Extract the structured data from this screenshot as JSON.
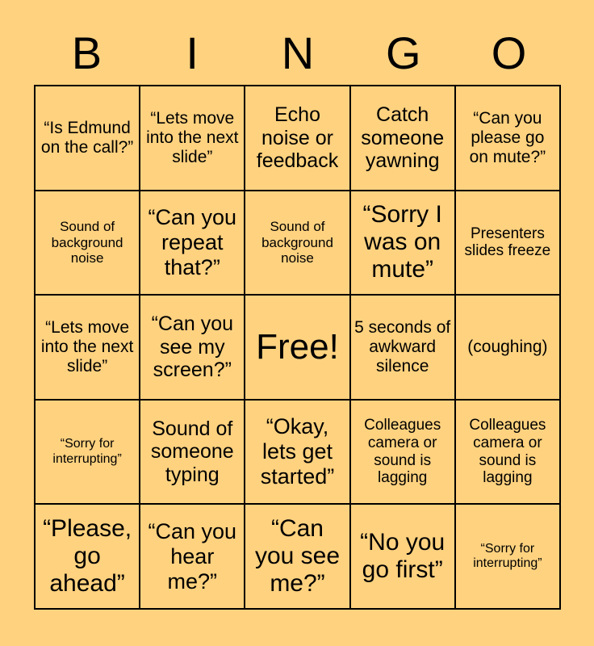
{
  "card": {
    "background_color": "#ffd27f",
    "text_color": "#000000",
    "border_color": "#000000",
    "header_letters": [
      "B",
      "I",
      "N",
      "G",
      "O"
    ],
    "grid_size": "5x5",
    "free_space_index": 12,
    "cells": [
      {
        "text": "“Is Edmund on the call?”",
        "size": "fs-m"
      },
      {
        "text": "“Lets move into the next slide”",
        "size": "fs-m"
      },
      {
        "text": "Echo noise or feedback",
        "size": "fs-l"
      },
      {
        "text": "Catch someone yawning",
        "size": "fs-l"
      },
      {
        "text": "“Can you please go on mute?”",
        "size": "fs-m"
      },
      {
        "text": "Sound of background noise",
        "size": "fs-s"
      },
      {
        "text": "“Can you repeat that?”",
        "size": "fs-xl"
      },
      {
        "text": "Sound of background noise",
        "size": "fs-s"
      },
      {
        "text": "“Sorry I was on mute”",
        "size": "fs-xxl"
      },
      {
        "text": "Presenters slides freeze",
        "size": "fs-sm"
      },
      {
        "text": "“Lets move into the next slide”",
        "size": "fs-m"
      },
      {
        "text": "“Can you see my screen?”",
        "size": "fs-l"
      },
      {
        "text": "Free!",
        "size": "fs-free"
      },
      {
        "text": "5 seconds of awkward silence",
        "size": "fs-m"
      },
      {
        "text": "(coughing)",
        "size": "fs-m"
      },
      {
        "text": "“Sorry for interrupting”",
        "size": "fs-xs"
      },
      {
        "text": "Sound of someone typing",
        "size": "fs-l"
      },
      {
        "text": "“Okay, lets get started”",
        "size": "fs-xl"
      },
      {
        "text": "Colleagues camera or sound is lagging",
        "size": "fs-sm"
      },
      {
        "text": "Colleagues camera or sound is lagging",
        "size": "fs-sm"
      },
      {
        "text": "“Please, go ahead”",
        "size": "fs-xxl"
      },
      {
        "text": "“Can you hear me?”",
        "size": "fs-xl"
      },
      {
        "text": "“Can you see me?”",
        "size": "fs-xxl"
      },
      {
        "text": "“No you go first”",
        "size": "fs-xxl"
      },
      {
        "text": "“Sorry for interrupting”",
        "size": "fs-xs"
      }
    ]
  }
}
